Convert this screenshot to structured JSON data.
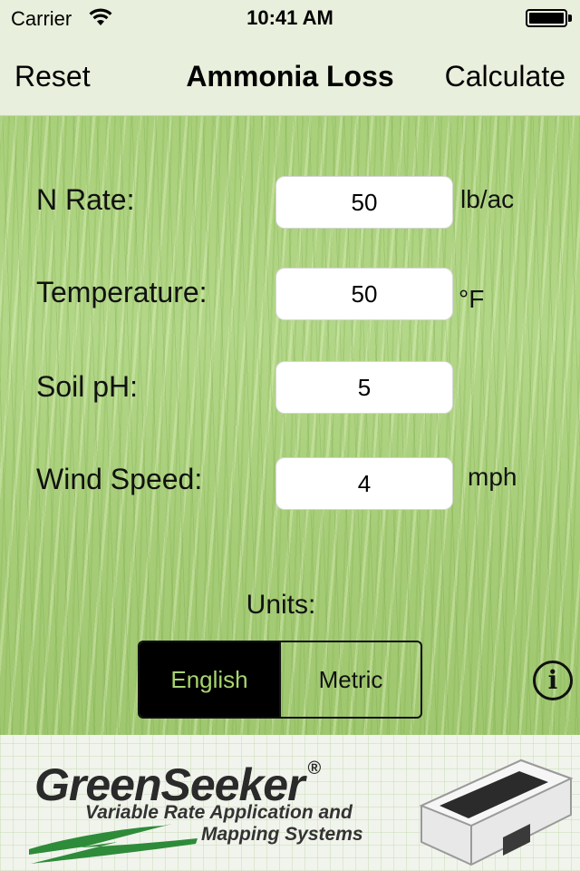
{
  "status_bar": {
    "carrier": "Carrier",
    "time": "10:41 AM"
  },
  "nav": {
    "left_label": "Reset",
    "title": "Ammonia Loss",
    "right_label": "Calculate"
  },
  "form": {
    "n_rate": {
      "label": "N Rate:",
      "value": "50",
      "unit": "lb/ac"
    },
    "temperature": {
      "label": "Temperature:",
      "value": "50",
      "unit": "°F"
    },
    "soil_ph": {
      "label": "Soil pH:",
      "value": "5"
    },
    "wind_speed": {
      "label": "Wind Speed:",
      "value": "4",
      "unit": "mph"
    }
  },
  "units": {
    "label": "Units:",
    "options": [
      "English",
      "Metric"
    ],
    "selected": "English"
  },
  "banner": {
    "brand": "GreenSeeker",
    "registered": "®",
    "tagline_line1": "Variable Rate Application and",
    "tagline_line2": "Mapping Systems"
  },
  "colors": {
    "accent_green": "#a8d46f",
    "bar_background": "#e8efdc"
  }
}
